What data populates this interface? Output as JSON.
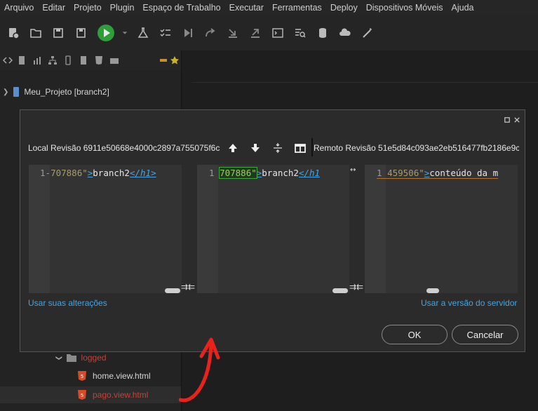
{
  "menu": [
    "Arquivo",
    "Editar",
    "Projeto",
    "Plugin",
    "Espaço de Trabalho",
    "Executar",
    "Ferramentas",
    "Deploy",
    "Dispositivos Móveis",
    "Ajuda"
  ],
  "toolbar": {
    "icons": [
      "new-project-icon",
      "open-folder-icon",
      "save-icon",
      "save-all-icon",
      "run-icon",
      "run-dropdown-icon",
      "test-flask-icon",
      "checklist-icon",
      "step-icon",
      "commit-icon",
      "pull-icon",
      "push-icon",
      "terminal-icon",
      "search-code-icon",
      "database-icon",
      "cloud-icon",
      "magic-wand-icon"
    ]
  },
  "tree": {
    "project": "Meu_Projeto [branch2]",
    "folder_logged": "logged",
    "file_home": "home.view.html",
    "file_pago": "pago.view.html"
  },
  "dialog": {
    "local_label": "Local Revisão 6911e50668e4000c2897a755075f6c",
    "remote_label": "Remoto Revisão 51e5d84c093ae2eb516477fb2186e9c",
    "left": {
      "line_no": "1",
      "marker": "-",
      "str": "707886\"",
      "tag_open": ">",
      "text": "branch2",
      "tag_close": "</h1>"
    },
    "mid": {
      "line_no": "1",
      "str": "707886\"",
      "tag_open": ">",
      "text": "branch2",
      "tag_close": "</h1"
    },
    "right": {
      "line_no": "1",
      "str": "459506\"",
      "tag_open": ">",
      "text": "conteúdo da m"
    },
    "use_local": "Usar suas alterações",
    "use_server": "Usar a versão do servidor",
    "ok": "OK",
    "cancel": "Cancelar"
  },
  "colors": {
    "accent_link": "#4aa3df",
    "annotation_red": "#e8231e"
  }
}
